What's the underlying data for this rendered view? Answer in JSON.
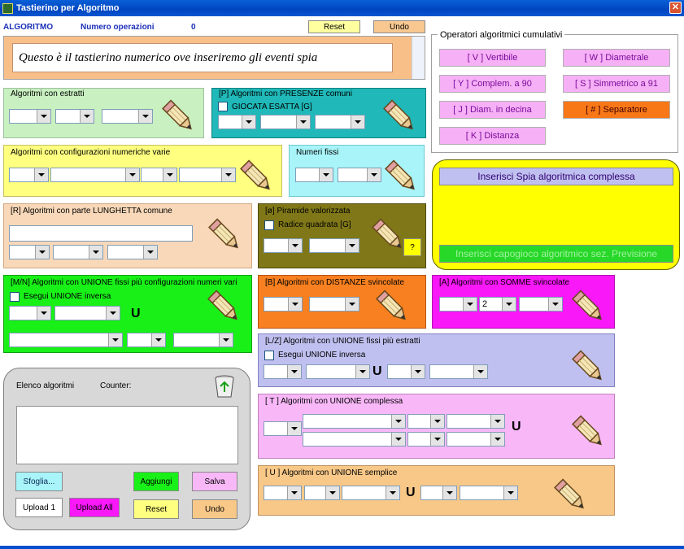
{
  "window": {
    "title": "Tastierino per Algoritmo"
  },
  "header": {
    "algoritmo": "ALGORITMO",
    "num_op_label": "Numero operazioni",
    "num_op_value": "0",
    "reset": "Reset",
    "undo": "Undo"
  },
  "input_text": "Questo è il tastierino numerico ove inseriremo gli eventi spia",
  "panels": {
    "estratti": "Algoritmi con estratti",
    "presenze": "[P] Algoritmi con PRESENZE comuni",
    "giocata": "GIOCATA ESATTA  [G]",
    "config": "Algoritmi con configurazioni numeriche varie",
    "fissi": "Numeri fissi",
    "lunghetta": "[R] Algoritmi con parte LUNGHETTA comune",
    "piramide": "[ø] Piramide valorizzata",
    "radice": "Radice quadrata  [G]",
    "help": "?",
    "unione_mn": "[M/N] Algoritmi con UNIONE fissi più configurazioni numeri vari",
    "esegui1": "Esegui UNIONE inversa",
    "distanze": "[B] Algoritmi con DISTANZE svincolate",
    "somme": "[A] Algoritmi con SOMME svincolate",
    "somme_val": "2",
    "unione_lz": "[L/Z] Algoritmi con UNIONE fissi più estratti",
    "esegui2": "Esegui UNIONE inversa",
    "unione_t": "[ T ] Algoritmi con UNIONE complessa",
    "unione_u": "[ U ] Algoritmi con UNIONE semplice",
    "U": "U"
  },
  "operators": {
    "title": "Operatori algoritmici cumulativi",
    "items": [
      "[ V ] Vertibile",
      "[ W ] Diametrale",
      "[ Y ] Complem. a 90",
      "[ S ] Simmetrico  a 91",
      "[ J ] Diam. in decina",
      "[ # ] Separatore",
      "[ K ] Distanza"
    ]
  },
  "spia": {
    "button": "Inserisci Spia algoritmica complessa",
    "capogioco": "Inserisci capogioco algoritmico sez. Previsione"
  },
  "elenco": {
    "title": "Elenco algoritmi",
    "counter": "Counter:",
    "sfoglia": "Sfoglia...",
    "aggiungi": "Aggiungi",
    "salva": "Salva",
    "upload1": "Upload 1",
    "uploadall": "Upload All",
    "reset": "Reset",
    "undo": "Undo"
  },
  "colors": {
    "green": "#c8f0c0",
    "teal": "#20b8b8",
    "yellow": "#ffff80",
    "cyan": "#a8f4f8",
    "peach": "#f8d8b8",
    "olive": "#807818",
    "lime": "#18f018",
    "orange": "#f88020",
    "magenta": "#f818f8",
    "lavender": "#c0c0f0",
    "pink": "#f8b8f8",
    "tan": "#f8c888"
  }
}
